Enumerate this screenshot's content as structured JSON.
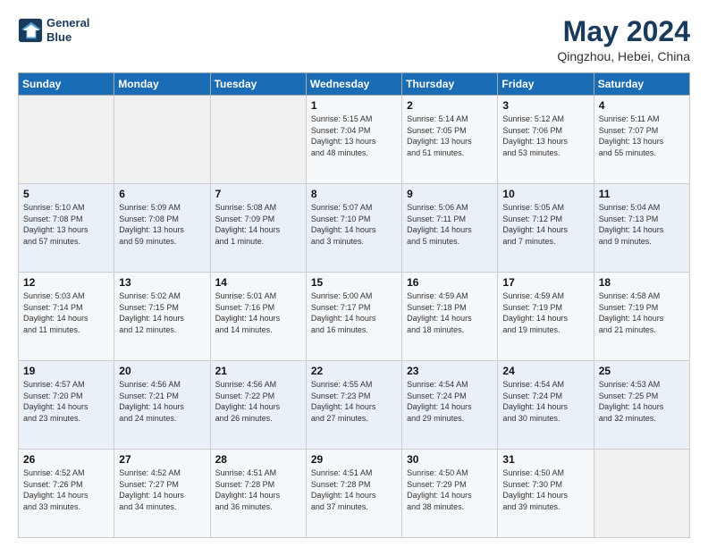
{
  "logo": {
    "line1": "General",
    "line2": "Blue"
  },
  "title": "May 2024",
  "location": "Qingzhou, Hebei, China",
  "weekdays": [
    "Sunday",
    "Monday",
    "Tuesday",
    "Wednesday",
    "Thursday",
    "Friday",
    "Saturday"
  ],
  "weeks": [
    [
      {
        "day": "",
        "info": ""
      },
      {
        "day": "",
        "info": ""
      },
      {
        "day": "",
        "info": ""
      },
      {
        "day": "1",
        "info": "Sunrise: 5:15 AM\nSunset: 7:04 PM\nDaylight: 13 hours\nand 48 minutes."
      },
      {
        "day": "2",
        "info": "Sunrise: 5:14 AM\nSunset: 7:05 PM\nDaylight: 13 hours\nand 51 minutes."
      },
      {
        "day": "3",
        "info": "Sunrise: 5:12 AM\nSunset: 7:06 PM\nDaylight: 13 hours\nand 53 minutes."
      },
      {
        "day": "4",
        "info": "Sunrise: 5:11 AM\nSunset: 7:07 PM\nDaylight: 13 hours\nand 55 minutes."
      }
    ],
    [
      {
        "day": "5",
        "info": "Sunrise: 5:10 AM\nSunset: 7:08 PM\nDaylight: 13 hours\nand 57 minutes."
      },
      {
        "day": "6",
        "info": "Sunrise: 5:09 AM\nSunset: 7:08 PM\nDaylight: 13 hours\nand 59 minutes."
      },
      {
        "day": "7",
        "info": "Sunrise: 5:08 AM\nSunset: 7:09 PM\nDaylight: 14 hours\nand 1 minute."
      },
      {
        "day": "8",
        "info": "Sunrise: 5:07 AM\nSunset: 7:10 PM\nDaylight: 14 hours\nand 3 minutes."
      },
      {
        "day": "9",
        "info": "Sunrise: 5:06 AM\nSunset: 7:11 PM\nDaylight: 14 hours\nand 5 minutes."
      },
      {
        "day": "10",
        "info": "Sunrise: 5:05 AM\nSunset: 7:12 PM\nDaylight: 14 hours\nand 7 minutes."
      },
      {
        "day": "11",
        "info": "Sunrise: 5:04 AM\nSunset: 7:13 PM\nDaylight: 14 hours\nand 9 minutes."
      }
    ],
    [
      {
        "day": "12",
        "info": "Sunrise: 5:03 AM\nSunset: 7:14 PM\nDaylight: 14 hours\nand 11 minutes."
      },
      {
        "day": "13",
        "info": "Sunrise: 5:02 AM\nSunset: 7:15 PM\nDaylight: 14 hours\nand 12 minutes."
      },
      {
        "day": "14",
        "info": "Sunrise: 5:01 AM\nSunset: 7:16 PM\nDaylight: 14 hours\nand 14 minutes."
      },
      {
        "day": "15",
        "info": "Sunrise: 5:00 AM\nSunset: 7:17 PM\nDaylight: 14 hours\nand 16 minutes."
      },
      {
        "day": "16",
        "info": "Sunrise: 4:59 AM\nSunset: 7:18 PM\nDaylight: 14 hours\nand 18 minutes."
      },
      {
        "day": "17",
        "info": "Sunrise: 4:59 AM\nSunset: 7:19 PM\nDaylight: 14 hours\nand 19 minutes."
      },
      {
        "day": "18",
        "info": "Sunrise: 4:58 AM\nSunset: 7:19 PM\nDaylight: 14 hours\nand 21 minutes."
      }
    ],
    [
      {
        "day": "19",
        "info": "Sunrise: 4:57 AM\nSunset: 7:20 PM\nDaylight: 14 hours\nand 23 minutes."
      },
      {
        "day": "20",
        "info": "Sunrise: 4:56 AM\nSunset: 7:21 PM\nDaylight: 14 hours\nand 24 minutes."
      },
      {
        "day": "21",
        "info": "Sunrise: 4:56 AM\nSunset: 7:22 PM\nDaylight: 14 hours\nand 26 minutes."
      },
      {
        "day": "22",
        "info": "Sunrise: 4:55 AM\nSunset: 7:23 PM\nDaylight: 14 hours\nand 27 minutes."
      },
      {
        "day": "23",
        "info": "Sunrise: 4:54 AM\nSunset: 7:24 PM\nDaylight: 14 hours\nand 29 minutes."
      },
      {
        "day": "24",
        "info": "Sunrise: 4:54 AM\nSunset: 7:24 PM\nDaylight: 14 hours\nand 30 minutes."
      },
      {
        "day": "25",
        "info": "Sunrise: 4:53 AM\nSunset: 7:25 PM\nDaylight: 14 hours\nand 32 minutes."
      }
    ],
    [
      {
        "day": "26",
        "info": "Sunrise: 4:52 AM\nSunset: 7:26 PM\nDaylight: 14 hours\nand 33 minutes."
      },
      {
        "day": "27",
        "info": "Sunrise: 4:52 AM\nSunset: 7:27 PM\nDaylight: 14 hours\nand 34 minutes."
      },
      {
        "day": "28",
        "info": "Sunrise: 4:51 AM\nSunset: 7:28 PM\nDaylight: 14 hours\nand 36 minutes."
      },
      {
        "day": "29",
        "info": "Sunrise: 4:51 AM\nSunset: 7:28 PM\nDaylight: 14 hours\nand 37 minutes."
      },
      {
        "day": "30",
        "info": "Sunrise: 4:50 AM\nSunset: 7:29 PM\nDaylight: 14 hours\nand 38 minutes."
      },
      {
        "day": "31",
        "info": "Sunrise: 4:50 AM\nSunset: 7:30 PM\nDaylight: 14 hours\nand 39 minutes."
      },
      {
        "day": "",
        "info": ""
      }
    ]
  ]
}
